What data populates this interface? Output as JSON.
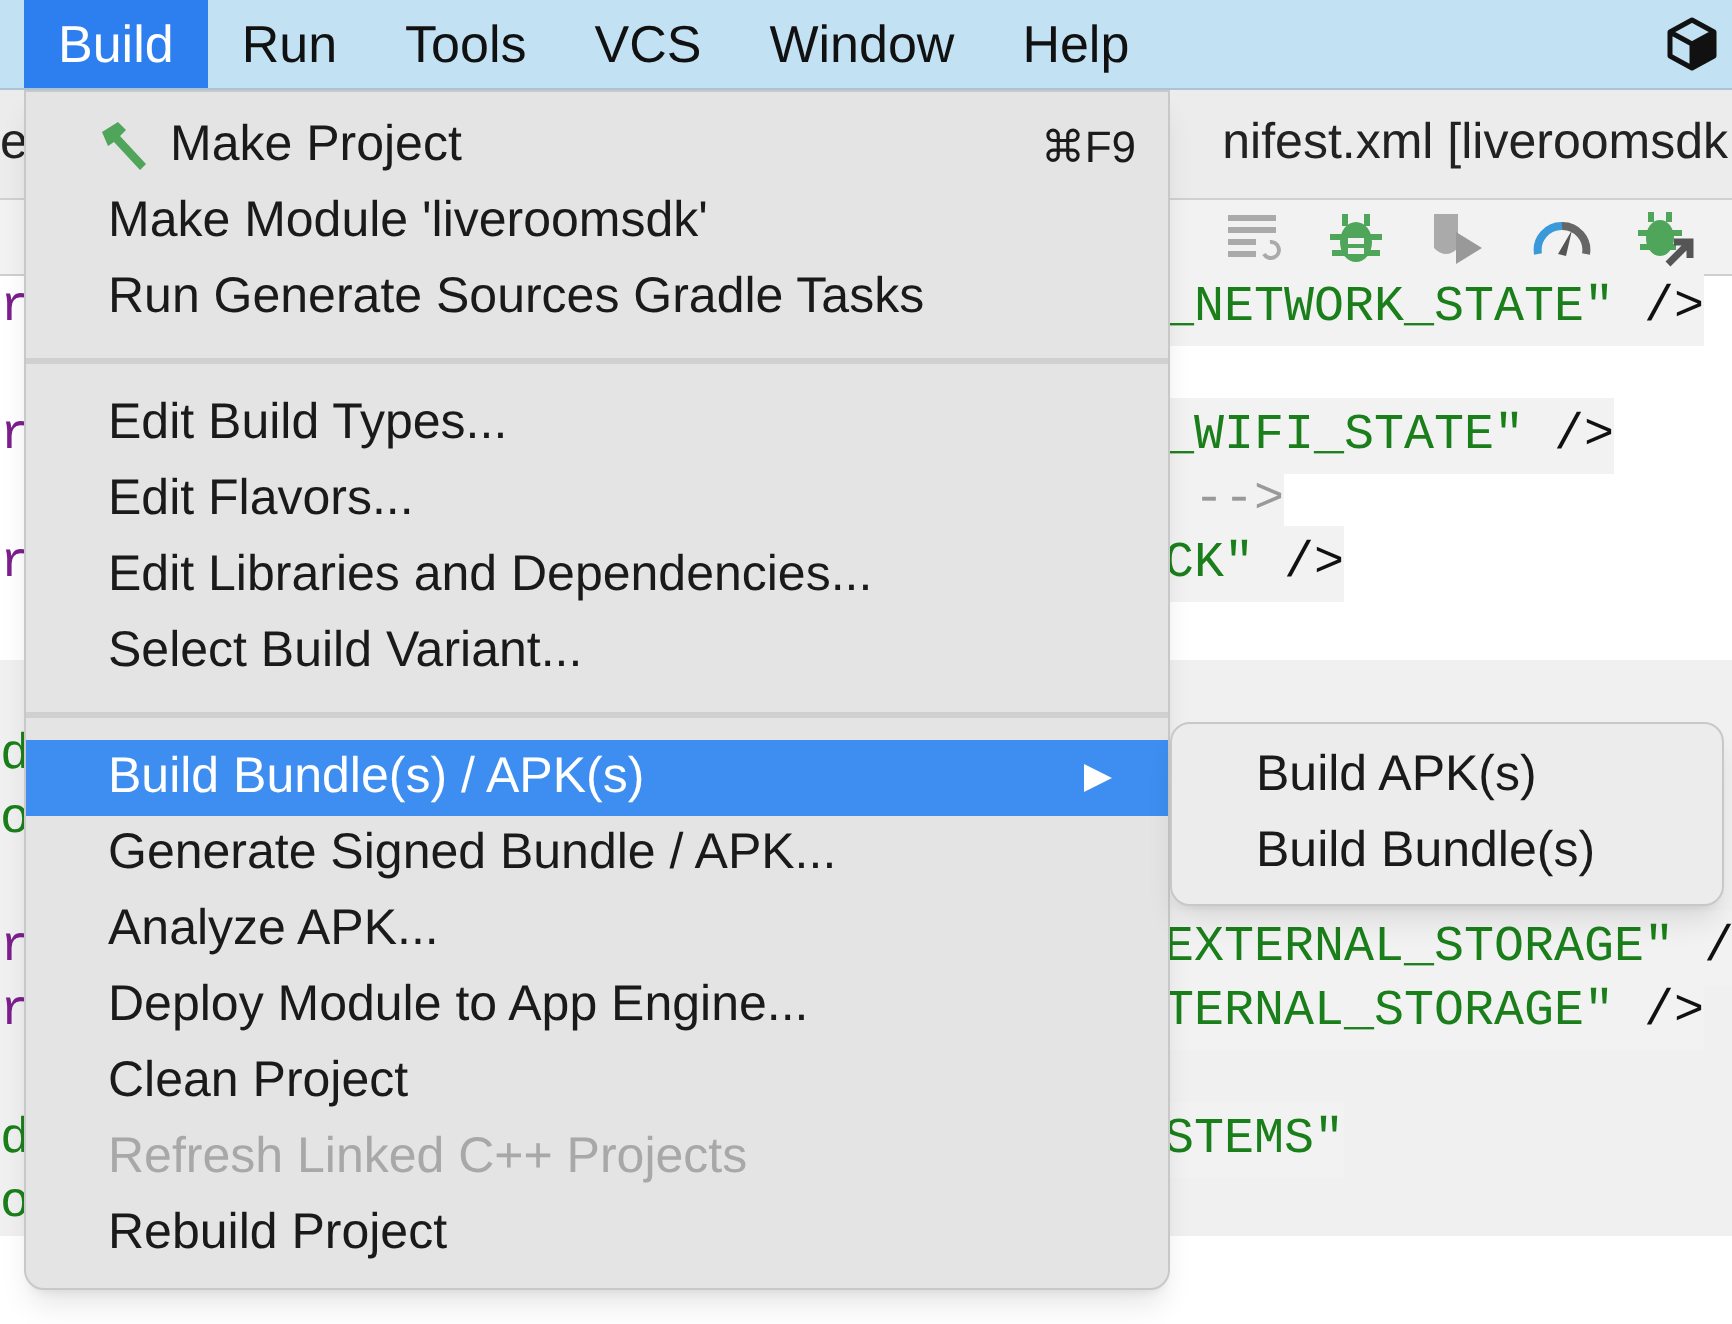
{
  "menu_bar": {
    "items": [
      {
        "label": "Build",
        "selected": true
      },
      {
        "label": "Run",
        "selected": false
      },
      {
        "label": "Tools",
        "selected": false
      },
      {
        "label": "VCS",
        "selected": false
      },
      {
        "label": "Window",
        "selected": false
      },
      {
        "label": "Help",
        "selected": false
      }
    ]
  },
  "window": {
    "title_left": "e",
    "title_right": "nifest.xml [liveroomsdk"
  },
  "editor": {
    "lines": [
      {
        "kind": "code",
        "left": {
          "text": "r",
          "kind": "tag"
        },
        "segments": [
          {
            "text": "_NETWORK_STATE\"",
            "kind": "string"
          },
          {
            "text": " />",
            "kind": "punct"
          }
        ]
      },
      {
        "kind": "blank"
      },
      {
        "kind": "code",
        "left": {
          "text": "r",
          "kind": "tag"
        },
        "segments": [
          {
            "text": "_WIFI_STATE\"",
            "kind": "string"
          },
          {
            "text": " />",
            "kind": "punct"
          }
        ]
      },
      {
        "kind": "code",
        "segments": [
          {
            "text": " -->",
            "kind": "comment"
          }
        ]
      },
      {
        "kind": "code",
        "left": {
          "text": "r",
          "kind": "tag"
        },
        "segments": [
          {
            "text": "CK\"",
            "kind": "string"
          },
          {
            "text": " />",
            "kind": "punct"
          }
        ]
      },
      {
        "kind": "blank"
      },
      {
        "kind": "blank"
      },
      {
        "kind": "code",
        "left": {
          "text": "d",
          "kind": "attr"
        }
      },
      {
        "kind": "code",
        "left": {
          "text": "o",
          "kind": "attr"
        }
      },
      {
        "kind": "blank"
      },
      {
        "kind": "code",
        "left": {
          "text": "r",
          "kind": "tag"
        },
        "segments": [
          {
            "text": "EXTERNAL_STORAGE\"",
            "kind": "string"
          },
          {
            "text": " /",
            "kind": "punct"
          }
        ]
      },
      {
        "kind": "code",
        "left": {
          "text": "r",
          "kind": "tag"
        },
        "segments": [
          {
            "text": "TERNAL_STORAGE\"",
            "kind": "string"
          },
          {
            "text": " />",
            "kind": "punct"
          }
        ]
      },
      {
        "kind": "blank"
      },
      {
        "kind": "code",
        "left": {
          "text": "d",
          "kind": "attr"
        },
        "segments": [
          {
            "text": "STEMS\"",
            "kind": "string"
          }
        ]
      },
      {
        "kind": "code",
        "left": {
          "text": "o",
          "kind": "attr"
        }
      }
    ]
  },
  "dropdown": {
    "sections": [
      {
        "items": [
          {
            "label": "Make Project",
            "kind": "with_icon",
            "shortcut": "⌘F9",
            "selected": false,
            "disabled": false
          },
          {
            "label": "Make Module 'liveroomsdk'",
            "kind": "plain",
            "selected": false,
            "disabled": false
          },
          {
            "label": "Run Generate Sources Gradle Tasks",
            "kind": "plain",
            "selected": false,
            "disabled": false
          }
        ]
      },
      {
        "items": [
          {
            "label": "Edit Build Types...",
            "kind": "plain",
            "selected": false,
            "disabled": false
          },
          {
            "label": "Edit Flavors...",
            "kind": "plain",
            "selected": false,
            "disabled": false
          },
          {
            "label": "Edit Libraries and Dependencies...",
            "kind": "plain",
            "selected": false,
            "disabled": false
          },
          {
            "label": "Select Build Variant...",
            "kind": "plain",
            "selected": false,
            "disabled": false
          }
        ]
      },
      {
        "items": [
          {
            "label": "Build Bundle(s) / APK(s)",
            "kind": "submenu",
            "selected": true,
            "disabled": false
          },
          {
            "label": "Generate Signed Bundle / APK...",
            "kind": "plain",
            "selected": false,
            "disabled": false
          },
          {
            "label": "Analyze APK...",
            "kind": "plain",
            "selected": false,
            "disabled": false
          },
          {
            "label": "Deploy Module to App Engine...",
            "kind": "plain",
            "selected": false,
            "disabled": false
          },
          {
            "label": "Clean Project",
            "kind": "plain",
            "selected": false,
            "disabled": false
          },
          {
            "label": "Refresh Linked C++ Projects",
            "kind": "plain",
            "selected": false,
            "disabled": true
          },
          {
            "label": "Rebuild Project",
            "kind": "plain",
            "selected": false,
            "disabled": false
          }
        ]
      }
    ]
  },
  "submenu": {
    "items": [
      {
        "label": "Build APK(s)"
      },
      {
        "label": "Build Bundle(s)"
      }
    ]
  }
}
